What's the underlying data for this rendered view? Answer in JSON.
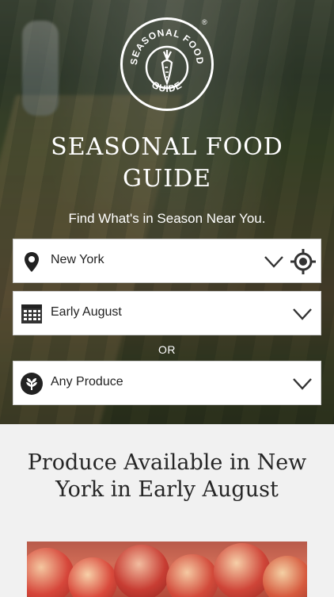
{
  "logo": {
    "text_top": "SEASONAL FOOD",
    "text_bottom": "GUIDE",
    "registered": "®"
  },
  "hero": {
    "title_line1": "SEASONAL FOOD",
    "title_line2": "GUIDE",
    "subtitle": "Find What's in Season Near You."
  },
  "form": {
    "location": {
      "value": "New York"
    },
    "date": {
      "value": "Early August"
    },
    "separator": "OR",
    "produce": {
      "value": "Any Produce"
    }
  },
  "results": {
    "headline": "Produce Available in New York in Early August"
  },
  "icons": {
    "location": "map-pin-icon",
    "geolocate": "crosshair-icon",
    "date": "calendar-icon",
    "produce": "leaf-icon",
    "dropdown": "chevron-down-icon"
  }
}
